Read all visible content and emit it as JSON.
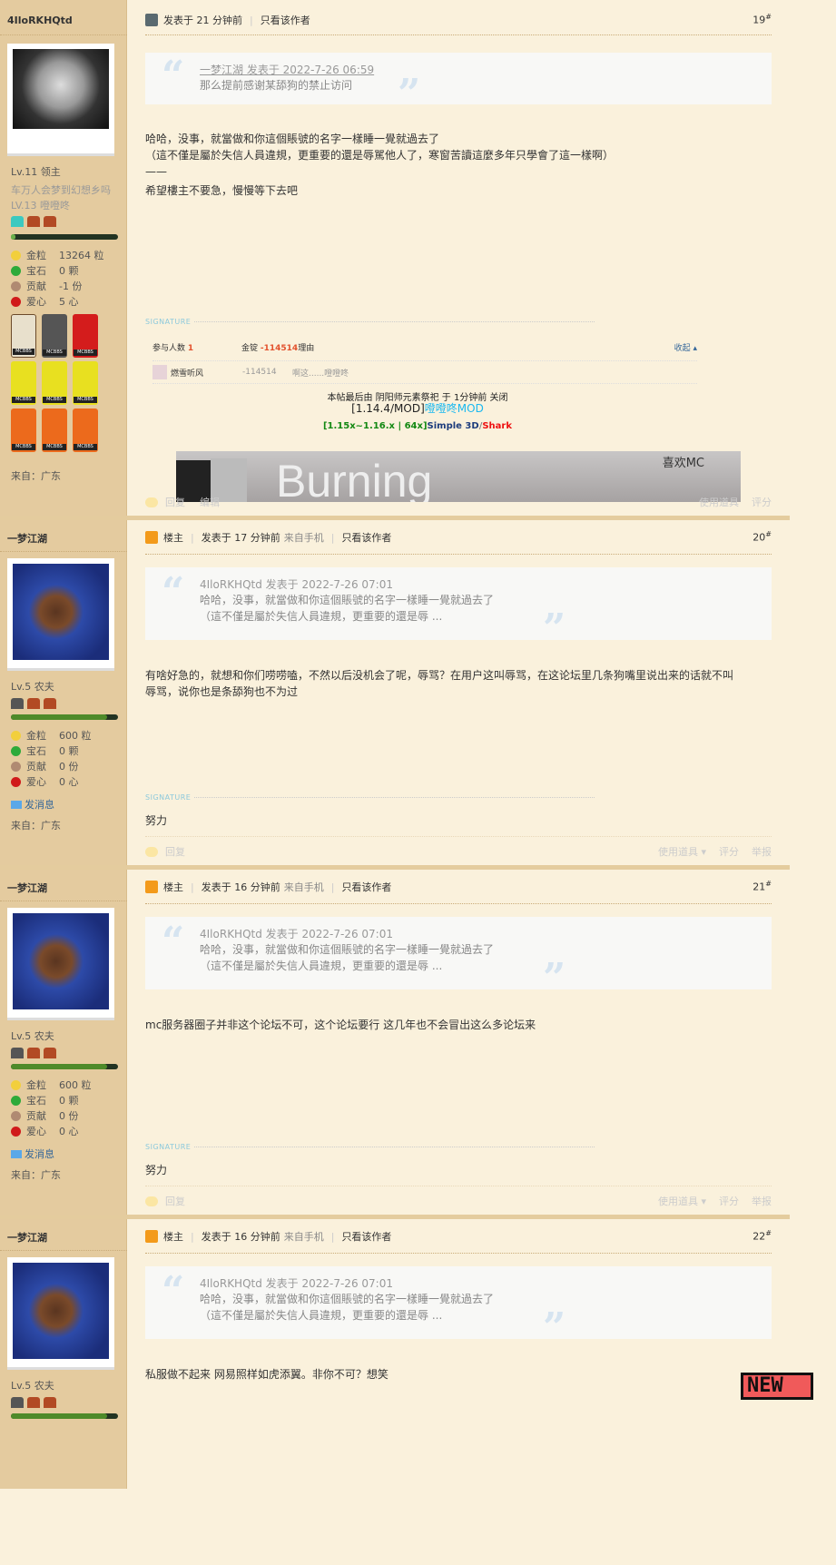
{
  "posts": [
    {
      "author": "4IloRKHQtd",
      "level": "Lv.11 领主",
      "extra_lines": [
        "车万人会梦到幻想乡吗",
        "LV.13 噔噔咚"
      ],
      "stats": [
        {
          "k": "金粒",
          "v": "13264 粒"
        },
        {
          "k": "宝石",
          "v": "0 颗"
        },
        {
          "k": "贡献",
          "v": "-1 份"
        },
        {
          "k": "爱心",
          "v": "5 心"
        }
      ],
      "medals": [
        "MCBBS",
        "MCBBS",
        "MCBBS",
        "MCBBS",
        "MCBBS",
        "MCBBS",
        "MCBBS",
        "MCBBS",
        "MCBBS"
      ],
      "from": "来自：广东",
      "posted": "发表于 21 分钟前",
      "only_author": "只看该作者",
      "floor": "19",
      "floor_mark": "#",
      "quote": {
        "head": "一梦江湖 发表于 2022-7-26 06:59",
        "lines": [
          "那么提前感谢某舔狗的禁止访问"
        ]
      },
      "content": [
        "哈哈，没事，就當做和你這個賬號的名字一樣睡一覺就過去了",
        "（這不僅是屬於失信人員違規，更重要的還是辱駡他人了，寒窗苦讀這麼多年只學會了這一樣啊）",
        "——",
        "希望樓主不要急，慢慢等下去吧"
      ],
      "signature_label": "SIGNATURE",
      "rate": {
        "participants_label": "参与人数",
        "participants": "1",
        "gold_label": "金锭",
        "gold": "-114514",
        "reason_label": "理由",
        "collapse": "收起",
        "row": {
          "user": "燃雪听风",
          "gold": "-114514",
          "reason": "啊这......噔噔咚"
        }
      },
      "sig_lines": {
        "closed": "本帖最后由 阴阳师元素祭祀 于 1分钟前 关闭",
        "mod_a": "[1.14.4/MOD]",
        "mod_b": "噔噔咚MOD",
        "tex_a": "[1.15x~1.16.x | 64x]",
        "tex_b": "Simple 3D",
        "tex_c": "/",
        "tex_d": "Shark",
        "banner_text": "喜欢MC"
      },
      "footer": {
        "reply": "回复",
        "edit": "编辑",
        "use_item": "使用道具",
        "rate": "评分"
      }
    },
    {
      "author": "一梦江湖",
      "level": "Lv.5 农夫",
      "op": "楼主",
      "stats": [
        {
          "k": "金粒",
          "v": "600 粒"
        },
        {
          "k": "宝石",
          "v": "0 颗"
        },
        {
          "k": "贡献",
          "v": "0 份"
        },
        {
          "k": "爱心",
          "v": "0 心"
        }
      ],
      "message": "发消息",
      "from": "来自：广东",
      "posted": "发表于 17 分钟前",
      "source": "来自手机",
      "only_author": "只看该作者",
      "floor": "20",
      "floor_mark": "#",
      "quote": {
        "head": "4IloRKHQtd 发表于 2022-7-26 07:01",
        "lines": [
          "哈哈，没事，就當做和你這個賬號的名字一樣睡一覺就過去了",
          "（這不僅是屬於失信人員違規，更重要的還是辱 ..."
        ]
      },
      "content": [
        "有啥好急的，就想和你们唠唠嗑，不然以后没机会了呢，辱骂？在用户这叫辱骂，在这论坛里几条狗嘴里说出来的话就不叫",
        "辱骂，说你也是条舔狗也不为过"
      ],
      "signature_label": "SIGNATURE",
      "signature": "努力",
      "footer": {
        "reply": "回复",
        "use_item": "使用道具",
        "rate": "评分",
        "report": "举报"
      }
    },
    {
      "author": "一梦江湖",
      "level": "Lv.5 农夫",
      "op": "楼主",
      "stats": [
        {
          "k": "金粒",
          "v": "600 粒"
        },
        {
          "k": "宝石",
          "v": "0 颗"
        },
        {
          "k": "贡献",
          "v": "0 份"
        },
        {
          "k": "爱心",
          "v": "0 心"
        }
      ],
      "message": "发消息",
      "from": "来自：广东",
      "posted": "发表于 16 分钟前",
      "source": "来自手机",
      "only_author": "只看该作者",
      "floor": "21",
      "floor_mark": "#",
      "quote": {
        "head": "4IloRKHQtd 发表于 2022-7-26 07:01",
        "lines": [
          "哈哈，没事，就當做和你這個賬號的名字一樣睡一覺就過去了",
          "（這不僅是屬於失信人員違規，更重要的還是辱 ..."
        ]
      },
      "content": [
        "mc服务器圈子并非这个论坛不可，这个论坛要行 这几年也不会冒出这么多论坛来"
      ],
      "signature_label": "SIGNATURE",
      "signature": "努力",
      "footer": {
        "reply": "回复",
        "use_item": "使用道具",
        "rate": "评分",
        "report": "举报"
      }
    },
    {
      "author": "一梦江湖",
      "level": "Lv.5 农夫",
      "op": "楼主",
      "posted": "发表于 16 分钟前",
      "source": "来自手机",
      "only_author": "只看该作者",
      "floor": "22",
      "floor_mark": "#",
      "quote": {
        "head": "4IloRKHQtd 发表于 2022-7-26 07:01",
        "lines": [
          "哈哈，没事，就當做和你這個賬號的名字一樣睡一覺就過去了",
          "（這不僅是屬於失信人員違規，更重要的還是辱 ..."
        ]
      },
      "content": [
        "私服做不起来 网易照样如虎添翼。非你不可？想笑"
      ],
      "new_badge": "NEW"
    }
  ]
}
